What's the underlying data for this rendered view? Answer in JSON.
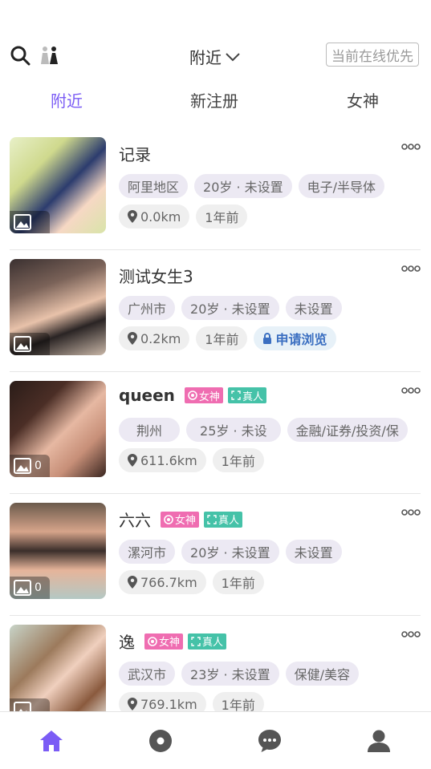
{
  "topbar": {
    "dropdown_label": "附近",
    "online_button": "当前在线优先"
  },
  "tabs": [
    {
      "label": "附近",
      "active": true
    },
    {
      "label": "新注册",
      "active": false
    },
    {
      "label": "女神",
      "active": false
    }
  ],
  "accent_color": "#7b5cf5",
  "users": [
    {
      "name": "记录",
      "tags": [
        "阿里地区",
        "20岁 · 未设置",
        "电子/半导体"
      ],
      "distance": "0.0km",
      "time": "1年前",
      "photo_count": "",
      "badges": []
    },
    {
      "name": "测试女生3",
      "tags": [
        "广州市",
        "20岁 · 未设置",
        "未设置"
      ],
      "distance": "0.2km",
      "time": "1年前",
      "apply": "申请浏览",
      "photo_count": "",
      "badges": []
    },
    {
      "name": "queen",
      "tags": [
        "荆州",
        "25岁 · 未设",
        "金融/证券/投资/保"
      ],
      "distance": "611.6km",
      "time": "1年前",
      "photo_count": "0",
      "badges": [
        "女神",
        "真人"
      ]
    },
    {
      "name": "六六",
      "tags": [
        "漯河市",
        "20岁 · 未设置",
        "未设置"
      ],
      "distance": "766.7km",
      "time": "1年前",
      "photo_count": "0",
      "badges": [
        "女神",
        "真人"
      ]
    },
    {
      "name": "逸",
      "tags": [
        "武汉市",
        "23岁 · 未设置",
        "保健/美容"
      ],
      "distance": "769.1km",
      "time": "1年前",
      "photo_count": "",
      "badges": [
        "女神",
        "真人"
      ]
    }
  ],
  "bottom_nav": [
    "home-icon",
    "discover-icon",
    "message-icon",
    "profile-icon"
  ]
}
